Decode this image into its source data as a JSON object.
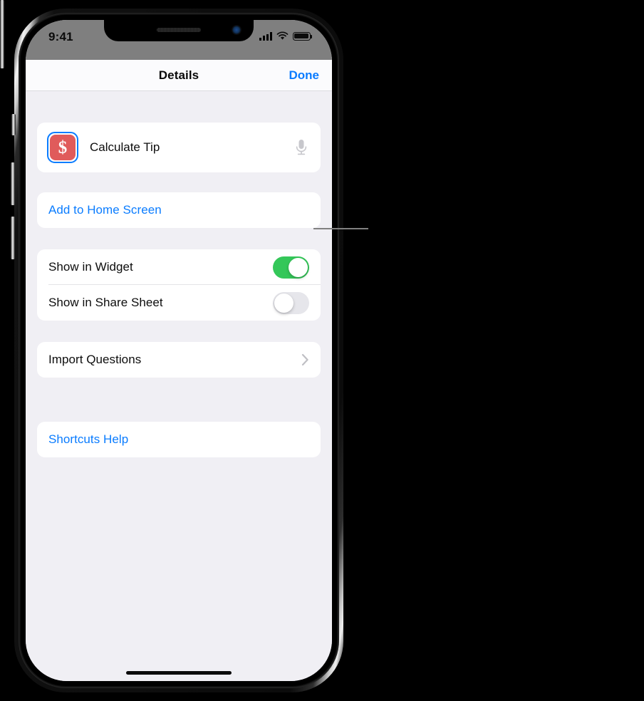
{
  "device": {
    "name": "iphone-x",
    "status_bar": {
      "time": "9:41",
      "cellular_icon": "signal-bars-icon",
      "wifi_icon": "wifi-icon",
      "battery_icon": "battery-full-icon"
    }
  },
  "nav": {
    "title": "Details",
    "done_label": "Done"
  },
  "shortcut": {
    "icon_glyph": "$",
    "icon_name": "dollar-sign-icon",
    "icon_color": "#E05B5B",
    "selection_color": "#0A7CFF",
    "name": "Calculate Tip",
    "voice_icon": "microphone-icon"
  },
  "sections": {
    "home_screen": {
      "label": "Add to Home Screen"
    },
    "visibility": {
      "rows": [
        {
          "label": "Show in Widget",
          "state": "on",
          "toggle_color": "#34C759"
        },
        {
          "label": "Show in Share Sheet",
          "state": "off",
          "toggle_color": "#E6E6EB"
        }
      ]
    },
    "import": {
      "label": "Import Questions",
      "disclosure_icon": "chevron-right-icon"
    },
    "help": {
      "label": "Shortcuts Help"
    }
  },
  "annotation": {
    "callout_line_color": "#808080",
    "target": "Add to Home Screen"
  },
  "colors": {
    "accent_blue": "#0A7CFF",
    "screen_background": "#F0EFF4",
    "card_background": "#FFFFFF",
    "navbar_background": "#FBFBFD",
    "status_bar_background": "#7F7F7F"
  }
}
